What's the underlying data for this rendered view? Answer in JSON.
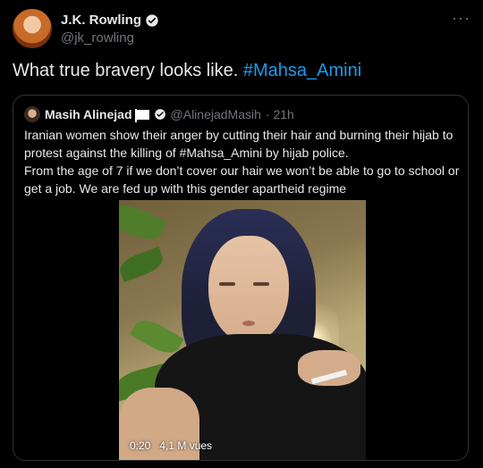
{
  "author": {
    "name": "J.K. Rowling",
    "handle": "@jk_rowling"
  },
  "menu": {
    "more_icon": "···"
  },
  "tweet": {
    "text": "What true bravery looks like. ",
    "hashtag": "#Mahsa_Amini"
  },
  "quote": {
    "name": "Masih Alinejad",
    "handle": "@AlinejadMasih",
    "time": "· 21h",
    "lines": [
      "Iranian women show their anger by cutting their hair and burning their hijab to protest against the killing of #Mahsa_Amini by hijab police.",
      "From the age of 7 if we don’t cover our hair we won’t be able to go to school or get a job. We are fed up with this gender apartheid regime"
    ],
    "video": {
      "duration": "0:20",
      "views": "4,1 M vues"
    }
  },
  "colors": {
    "accent": "#1d9bf0",
    "background": "#000000",
    "muted": "#71767b",
    "border": "#2f3336"
  }
}
